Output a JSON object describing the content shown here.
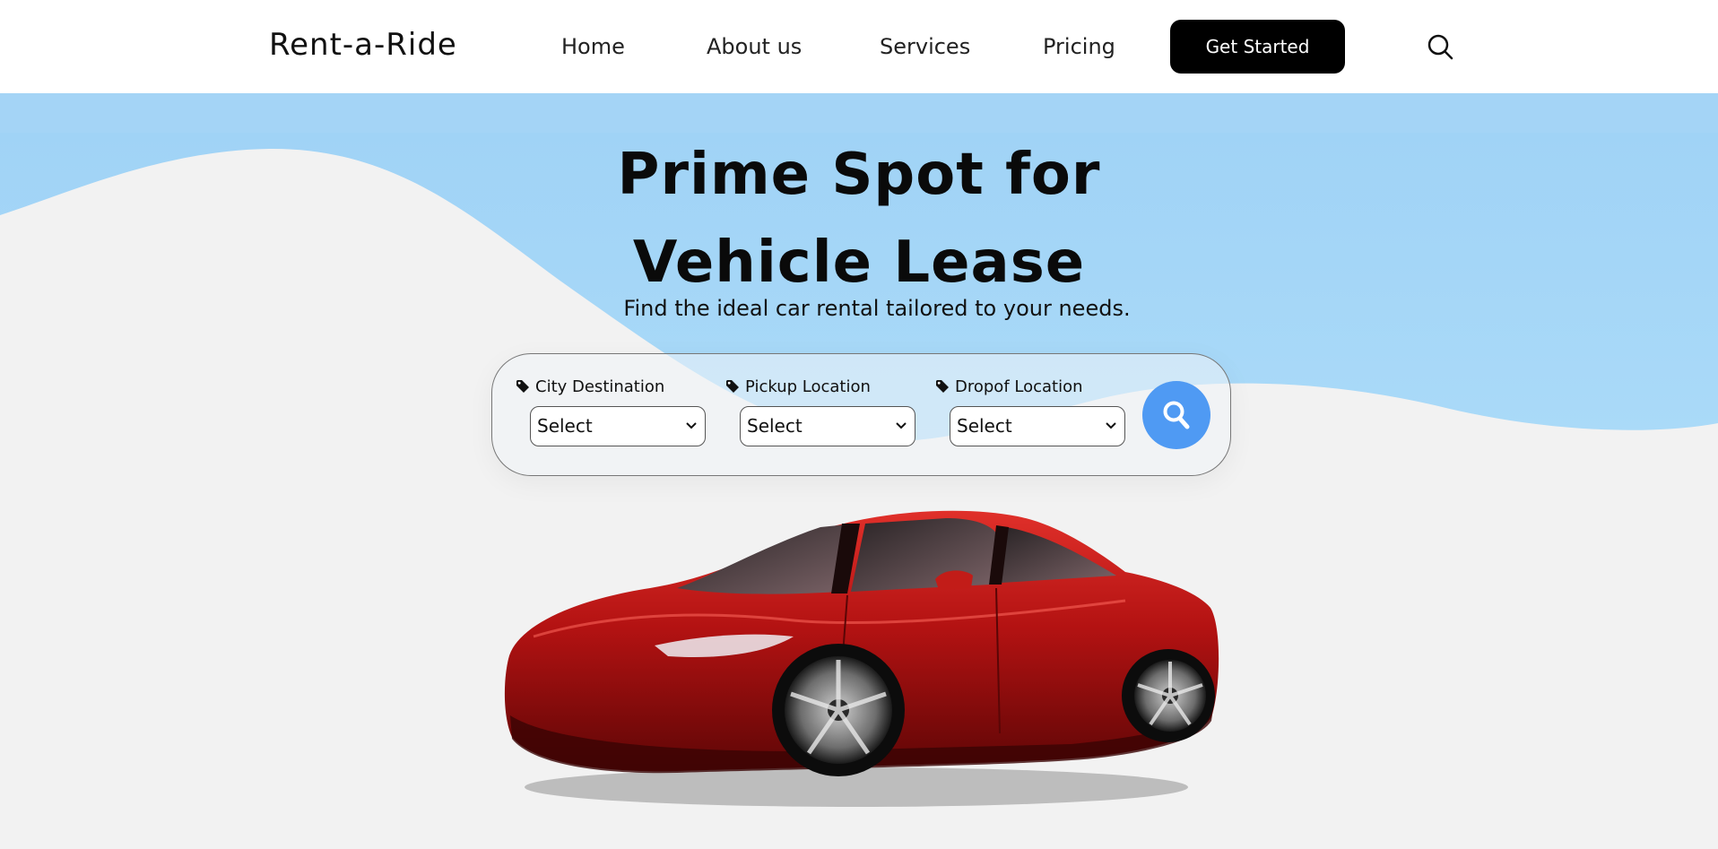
{
  "header": {
    "logo": "Rent-a-Ride",
    "nav": [
      "Home",
      "About us",
      "Services",
      "Pricing"
    ],
    "cta_label": "Get Started",
    "search_icon": "search-icon"
  },
  "hero": {
    "title_line1": "Prime Spot for",
    "title_line2": "Vehicle Lease",
    "subtitle": "Find the ideal car rental tailored to your needs."
  },
  "search": {
    "fields": [
      {
        "label": "City Destination",
        "value": "Select",
        "icon": "tag-icon"
      },
      {
        "label": "Pickup Location",
        "value": "Select",
        "icon": "tag-icon"
      },
      {
        "label": "Dropof Location",
        "value": "Select",
        "icon": "tag-icon"
      }
    ],
    "button_icon": "search-icon"
  },
  "colors": {
    "accent": "#4f9af3",
    "wave": "#aad8f7",
    "background": "#f2f2f2",
    "cta": "#000000",
    "car": "#b31212"
  }
}
